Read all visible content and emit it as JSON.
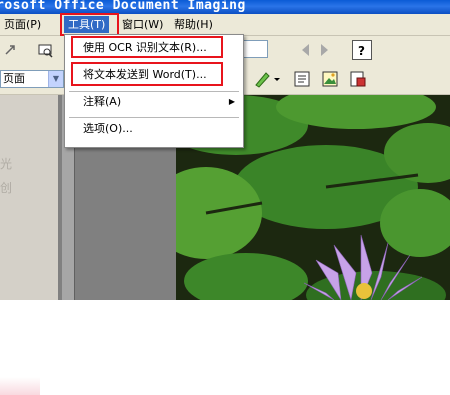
{
  "window": {
    "title": "rosoft Office Document Imaging"
  },
  "menubar": {
    "items": [
      {
        "label": "页面(P)"
      },
      {
        "label": "工具(T)"
      },
      {
        "label": "窗口(W)"
      },
      {
        "label": "帮助(H)"
      }
    ]
  },
  "tools_menu": {
    "items": [
      {
        "label": "使用 OCR 识别文本(R)..."
      },
      {
        "label": "将文本发送到 Word(T)..."
      },
      {
        "label": "注释(A)"
      },
      {
        "label": "选项(O)..."
      }
    ]
  },
  "toolbar": {
    "view_mode": "页面"
  },
  "sidebar": {
    "ghost_text": [
      "光",
      "创"
    ]
  },
  "colors": {
    "highlight": "#e8141c",
    "menu_selected": "#316ac5",
    "titlebar": "#0a5bd6"
  }
}
